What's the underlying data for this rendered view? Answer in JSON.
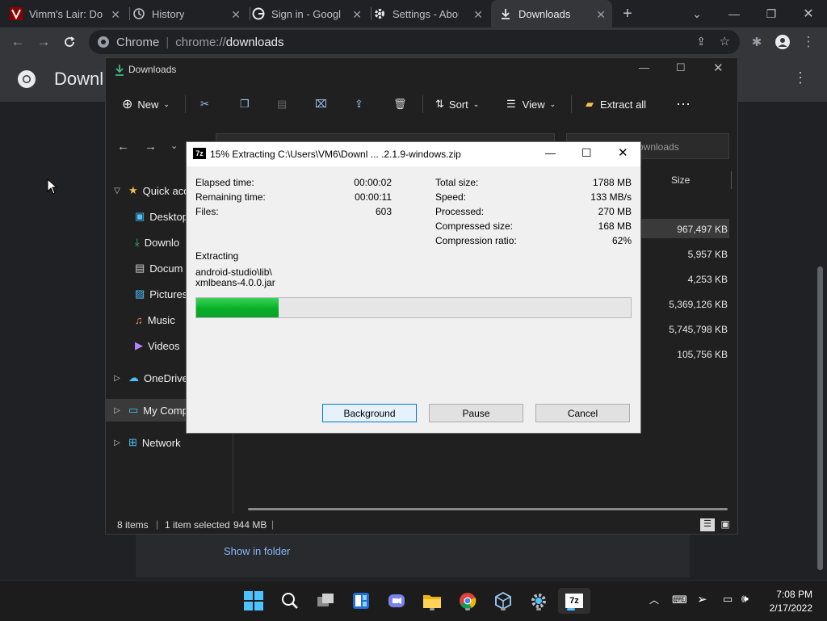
{
  "browser": {
    "tabs": [
      {
        "title": "Vimm's Lair: Do",
        "icon": "vimm-icon"
      },
      {
        "title": "History",
        "icon": "history-icon"
      },
      {
        "title": "Sign in - Google",
        "icon": "google-icon"
      },
      {
        "title": "Settings - Abou",
        "icon": "settings-icon"
      },
      {
        "title": "Downloads",
        "icon": "download-icon",
        "active": true
      }
    ],
    "omnibox": {
      "site": "Chrome",
      "url_scheme": "chrome://",
      "url_path": "downloads"
    }
  },
  "chrome_page": {
    "title": "Downl",
    "show_in_folder": "Show in folder"
  },
  "explorer": {
    "title": "Downloads",
    "commands": {
      "new": "New",
      "sort": "Sort",
      "view": "View",
      "extract_all": "Extract all"
    },
    "search_placeholder": "ownloads",
    "size_header": "Size",
    "nav": [
      {
        "label": "Quick acc",
        "icon": "star-icon"
      },
      {
        "label": "Desktop",
        "icon": "desktop-icon"
      },
      {
        "label": "Downlo",
        "icon": "download-icon"
      },
      {
        "label": "Docum",
        "icon": "documents-icon"
      },
      {
        "label": "Pictures",
        "icon": "pictures-icon"
      },
      {
        "label": "Music",
        "icon": "music-icon"
      },
      {
        "label": "Videos",
        "icon": "videos-icon"
      },
      {
        "label": "OneDrive",
        "icon": "onedrive-icon"
      },
      {
        "label": "My Comp",
        "icon": "computer-icon"
      },
      {
        "label": "Network",
        "icon": "network-icon"
      }
    ],
    "file_sizes": [
      "967,497 KB",
      "5,957 KB",
      "4,253 KB",
      "5,369,126 KB",
      "5,745,798 KB",
      "105,756 KB"
    ],
    "status": {
      "items": "8 items",
      "selected": "1 item selected",
      "size": "944 MB"
    }
  },
  "dialog": {
    "title": "15% Extracting C:\\Users\\VM6\\Downl ... .2.1.9-windows.zip",
    "left_stats": [
      {
        "label": "Elapsed time:",
        "value": "00:00:02"
      },
      {
        "label": "Remaining time:",
        "value": "00:00:11"
      },
      {
        "label": "Files:",
        "value": "603"
      }
    ],
    "right_stats": [
      {
        "label": "Total size:",
        "value": "1788 MB"
      },
      {
        "label": "Speed:",
        "value": "133 MB/s"
      },
      {
        "label": "Processed:",
        "value": "270 MB"
      },
      {
        "label": "Compressed size:",
        "value": "168 MB"
      },
      {
        "label": "Compression ratio:",
        "value": "62%"
      }
    ],
    "extracting_label": "Extracting",
    "current_path": "android-studio\\lib\\",
    "current_file": "xmlbeans-4.0.0.jar",
    "progress_fraction": 0.19,
    "buttons": {
      "background": "Background",
      "pause": "Pause",
      "cancel": "Cancel"
    }
  },
  "taskbar": {
    "time": "7:08 PM",
    "date": "2/17/2022"
  },
  "colors": {
    "progress_green": "#06b025",
    "accent_blue": "#0078d4"
  }
}
